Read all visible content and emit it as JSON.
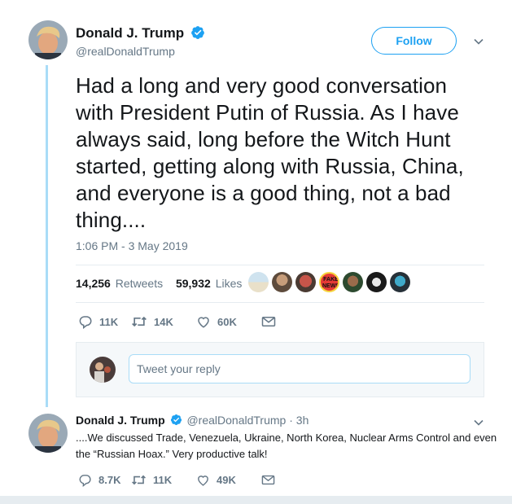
{
  "tweet": {
    "author_name": "Donald J. Trump",
    "author_handle": "@realDonaldTrump",
    "follow_label": "Follow",
    "text": "Had a long and very good conversation with President Putin of Russia. As I have always said, long before the Witch Hunt started, getting along with Russia, China, and everyone is a good thing, not a bad thing....",
    "timestamp": "1:06 PM - 3 May 2019",
    "retweets_count": "14,256",
    "retweets_label": "Retweets",
    "likes_count": "59,932",
    "likes_label": "Likes",
    "reply_count": "11K",
    "retweet_count_short": "14K",
    "like_count_short": "60K",
    "liker_fake_news_label": "FAKE NEWS"
  },
  "reply_composer": {
    "placeholder": "Tweet your reply"
  },
  "reply_tweet": {
    "author_name": "Donald J. Trump",
    "author_handle": "@realDonaldTrump",
    "separator": "·",
    "time_ago": "3h",
    "text": "....We discussed Trade, Venezuela, Ukraine, North Korea, Nuclear Arms Control and even the “Russian Hoax.” Very productive talk!",
    "reply_count": "8.7K",
    "retweet_count": "11K",
    "like_count": "49K"
  },
  "icons": [
    "verified-badge-icon",
    "chevron-down-icon",
    "reply-icon",
    "retweet-icon",
    "like-icon",
    "dm-icon"
  ],
  "colors": {
    "accent": "#1da1f2",
    "thread_line": "#a9dcf7",
    "secondary_text": "#657786",
    "divider": "#e6ecf0"
  }
}
